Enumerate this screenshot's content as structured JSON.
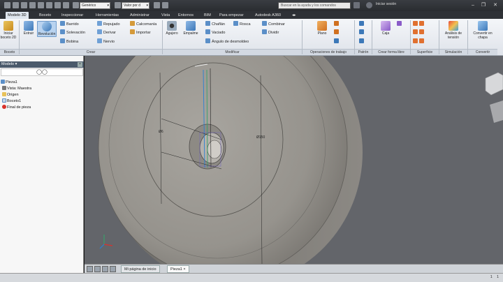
{
  "quick_access": {
    "material_value": "Genérico",
    "appearance_value": "Valor por d",
    "search_placeholder": "Buscar en la ayuda y los comandos",
    "signin_label": "Iniciar sesión",
    "minimize": "–",
    "restore": "❐",
    "close": "✕"
  },
  "tabs": [
    {
      "label": "Modelo 3D"
    },
    {
      "label": "Boceto"
    },
    {
      "label": "Inspeccionar"
    },
    {
      "label": "Herramientas"
    },
    {
      "label": "Administrar"
    },
    {
      "label": "Vista"
    },
    {
      "label": "Entornos"
    },
    {
      "label": "BIM"
    },
    {
      "label": "Para empezar"
    },
    {
      "label": "Autodesk A360"
    }
  ],
  "ribbon": {
    "sketch": {
      "start_label": "Iniciar boceto 2D",
      "panel": "Boceto"
    },
    "create": {
      "extrude": "Extruir",
      "revolve": "Revolución",
      "sweep": "Barrido",
      "loft": "Solevación",
      "coil": "Bobina",
      "emboss": "Repujado",
      "derive": "Derivar",
      "rib": "Nervio",
      "decal": "Calcomanía",
      "import": "Importar",
      "panel": "Crear"
    },
    "modify": {
      "hole": "Agujero",
      "fillet": "Empalme",
      "chamfer": "Chaflán",
      "shell": "Vaciado",
      "draft": "Ángulo de desmoldeo",
      "thread": "Rosca",
      "combine": "Combinar",
      "split": "Dividir",
      "panel": "Modificar"
    },
    "work_features": {
      "plane": "Plano",
      "panel": "Operaciones de trabajo"
    },
    "pattern": {
      "panel": "Patrón"
    },
    "freeform": {
      "box": "Caja",
      "panel": "Crear forma libre"
    },
    "surface": {
      "panel": "Superficie"
    },
    "simulation": {
      "stress": "Análisis de tensión",
      "panel": "Simulación"
    },
    "convert": {
      "sheetmetal": "Convertir en chapa",
      "panel": "Convertir"
    }
  },
  "browser": {
    "title": "Modelo",
    "close": "×",
    "filter_icon": "binoculars-icon",
    "items": [
      {
        "label": "Pieza1"
      },
      {
        "label": "Vista: Maestra"
      },
      {
        "label": "Origen"
      },
      {
        "label": "Boceto1"
      },
      {
        "label": "Final de pieza"
      }
    ]
  },
  "viewport": {
    "dim_small": "Ø6",
    "dim_large": "Ø150"
  },
  "doc_tabs": [
    {
      "label": "Mi página de inicio"
    },
    {
      "label": "Pieza1"
    }
  ],
  "doc_tab_close": "×",
  "status": {
    "count1": "1",
    "count2": "1"
  },
  "colors": {
    "ribbon_bg": "#e6eaf0",
    "accent_blue": "#2a7fd4",
    "part_face": "#9a9791",
    "viewport_bg": "#63656a"
  }
}
